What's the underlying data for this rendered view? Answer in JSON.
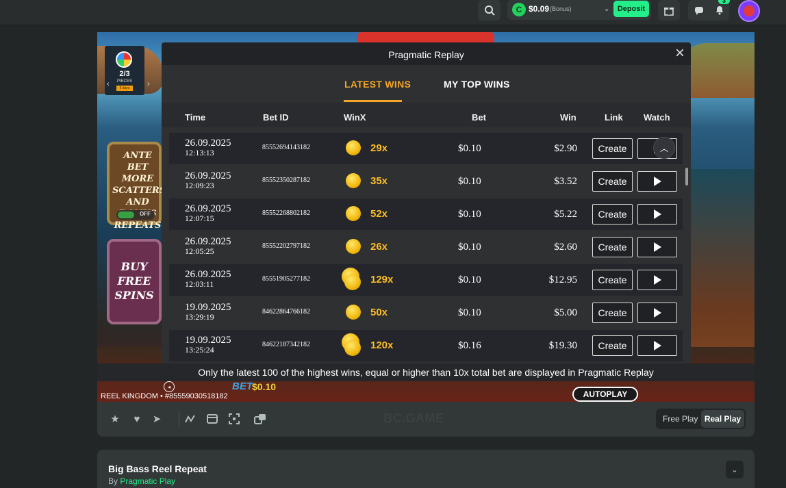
{
  "header": {
    "balance": "$0.09",
    "balance_note": "(Bonus)",
    "deposit_label": "Deposit",
    "notification_count": "3"
  },
  "game": {
    "pieces_count": "2/3",
    "pieces_label": "PIECES",
    "pieces_days": "5 days",
    "ante_text": "ANTE BET MORE SCATTERS AND BONUS REPEATS",
    "ante_toggle_label": "OFF",
    "buy_text": "BUY FREE SPINS",
    "bet_label": "BET",
    "bet_value": "$0.10",
    "provider_credit": "REEL KINGDOM • #85559030518182",
    "autoplay_label": "AUTOPLAY"
  },
  "replay_modal": {
    "title": "Pragmatic Replay",
    "tabs": [
      "LATEST WINS",
      "MY TOP WINS"
    ],
    "active_tab": "LATEST WINS",
    "columns": [
      "Time",
      "Bet ID",
      "WinX",
      "Bet",
      "Win",
      "Link",
      "Watch"
    ],
    "rows": [
      {
        "date": "26.09.2025",
        "time": "12:13:13",
        "bet_id": "85552694143182",
        "winx": "29x",
        "bet": "$0.10",
        "win": "$2.90",
        "link": "Create"
      },
      {
        "date": "26.09.2025",
        "time": "12:09:23",
        "bet_id": "85552350287182",
        "winx": "35x",
        "bet": "$0.10",
        "win": "$3.52",
        "link": "Create"
      },
      {
        "date": "26.09.2025",
        "time": "12:07:15",
        "bet_id": "85552268802182",
        "winx": "52x",
        "bet": "$0.10",
        "win": "$5.22",
        "link": "Create"
      },
      {
        "date": "26.09.2025",
        "time": "12:05:25",
        "bet_id": "85552202797182",
        "winx": "26x",
        "bet": "$0.10",
        "win": "$2.60",
        "link": "Create"
      },
      {
        "date": "26.09.2025",
        "time": "12:03:11",
        "bet_id": "85551905277182",
        "winx": "129x",
        "bet": "$0.10",
        "win": "$12.95",
        "link": "Create"
      },
      {
        "date": "19.09.2025",
        "time": "13:29:19",
        "bet_id": "84622864766182",
        "winx": "50x",
        "bet": "$0.10",
        "win": "$5.00",
        "link": "Create"
      },
      {
        "date": "19.09.2025",
        "time": "13:25:24",
        "bet_id": "84622187342182",
        "winx": "120x",
        "bet": "$0.16",
        "win": "$19.30",
        "link": "Create"
      }
    ],
    "footnote": "Only the latest 100 of the highest wins, equal or higher than 10x total bet are displayed in Pragmatic Replay"
  },
  "controls": {
    "watermark": "BC.GAME",
    "free_play_label": "Free Play",
    "real_play_label": "Real Play",
    "active_mode": "Real Play"
  },
  "info": {
    "game_title": "Big Bass Reel Repeat",
    "by_label": "By",
    "provider": "Pragmatic Play"
  },
  "colors": {
    "accent_green": "#24ee89",
    "tab_active": "#f3a626",
    "winx": "#ffbd24"
  }
}
